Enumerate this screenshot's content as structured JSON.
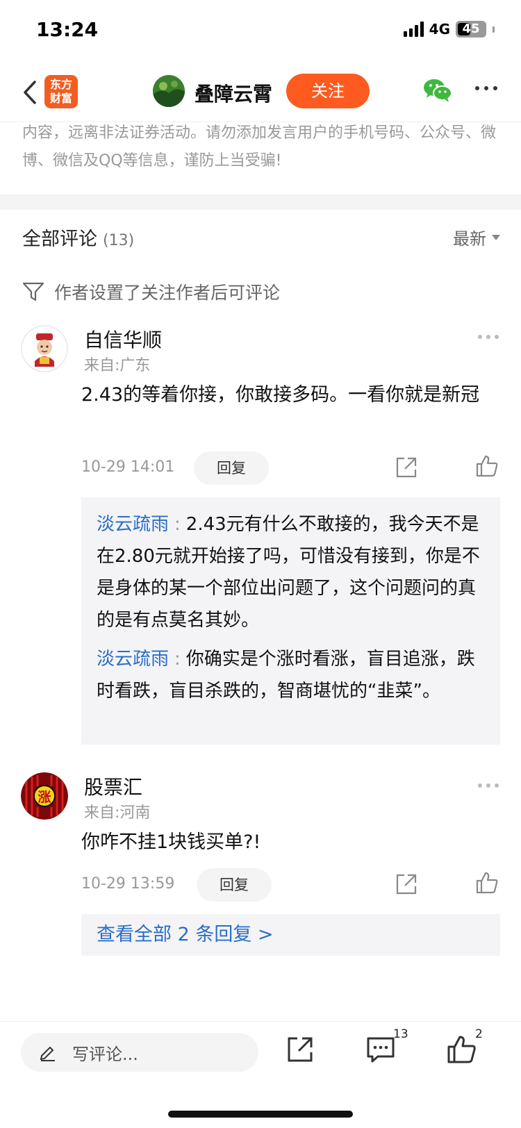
{
  "status_bar": {
    "time": "13:24",
    "network": "4G",
    "battery": "45"
  },
  "header": {
    "logo_line1": "东方",
    "logo_line2": "财富",
    "author_name": "叠障云霄",
    "follow_label": "关注"
  },
  "notice": "内容，远离非法证券活动。请勿添加发言用户的手机号码、公众号、微博、微信及QQ等信息，谨防上当受骗!",
  "comments_section": {
    "title": "全部评论",
    "count": "(13)",
    "sort_label": "最新",
    "restriction": "作者设置了关注作者后可评论"
  },
  "comments": [
    {
      "name": "自信华顺",
      "location": "来自:广东",
      "text": "2.43的等着你接，你敢接多码。一看你就是新冠",
      "time": "10-29 14:01",
      "reply_label": "回复",
      "replies": [
        {
          "user": "淡云疏雨",
          "colon": ":",
          "text": "2.43元有什么不敢接的，我今天不是在2.80元就开始接了吗，可惜没有接到，你是不是身体的某一个部位出问题了，这个问题问的真的是有点莫名其妙。"
        },
        {
          "user": "淡云疏雨",
          "colon": ":",
          "text": "你确实是个涨时看涨，盲目追涨，跌时看跌，盲目杀跌的，智商堪忧的“韭菜”。"
        }
      ]
    },
    {
      "name": "股票汇",
      "avatar_char": "涨",
      "location": "来自:河南",
      "text": "你咋不挂1块钱买单?!",
      "time": "10-29 13:59",
      "reply_label": "回复",
      "view_all": "查看全部 2 条回复 >"
    }
  ],
  "bottom_bar": {
    "comment_placeholder": "写评论...",
    "comment_count": "13",
    "like_count": "2"
  },
  "colors": {
    "accent": "#ff5a1f",
    "link": "#2a6ec6",
    "muted": "#999999"
  }
}
